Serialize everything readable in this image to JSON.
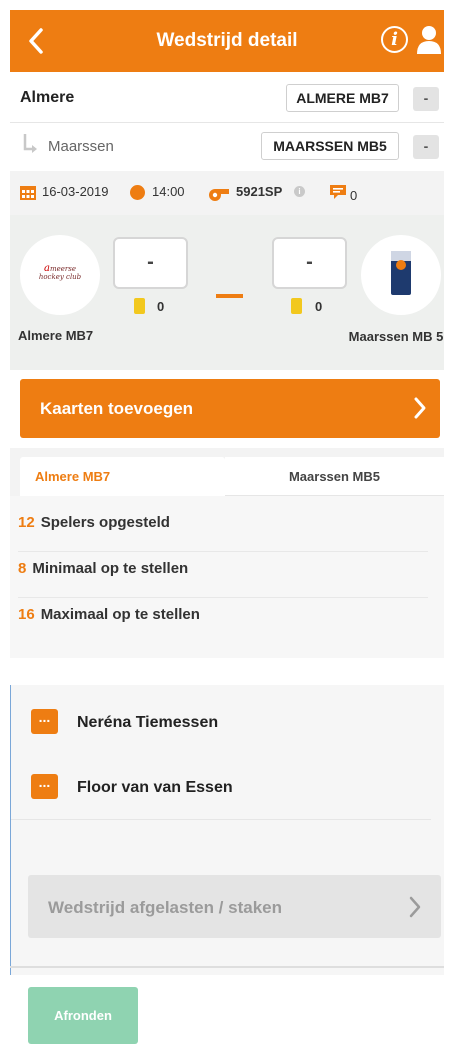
{
  "header": {
    "title": "Wedstrijd detail"
  },
  "home": {
    "name": "Almere",
    "code": "ALMERE MB7",
    "remove_label": "-",
    "logo_text_1": "a",
    "logo_text_2": "meerse",
    "logo_text_3": "hockey club",
    "display": "Almere MB7",
    "score": "-",
    "cards": "0"
  },
  "away": {
    "name": "Maarssen",
    "code": "MAARSSEN MB5",
    "remove_label": "-",
    "display": "Maarssen MB 5",
    "score": "-",
    "cards": "0"
  },
  "info": {
    "date": "16-03-2019",
    "time": "14:00",
    "code": "5921SP",
    "info_glyph": "i",
    "comments": "0"
  },
  "cards_button": {
    "label": "Kaarten toevoegen"
  },
  "tabs": [
    {
      "label": "Almere MB7",
      "active": true
    },
    {
      "label": "Maarssen MB5",
      "active": false
    }
  ],
  "stats": [
    {
      "value": "12",
      "label": "Spelers opgesteld"
    },
    {
      "value": "8",
      "label": "Minimaal op te stellen"
    },
    {
      "value": "16",
      "label": "Maximaal op te stellen"
    }
  ],
  "players": [
    {
      "name": "Neréna Tiemessen",
      "action": "..."
    },
    {
      "name": "Floor van van Essen",
      "action": "..."
    }
  ],
  "cancel_button": {
    "label": "Wedstrijd afgelasten / staken"
  },
  "finish_button": {
    "label": "Afronden"
  },
  "colors": {
    "accent": "#ee7d12",
    "finish": "#8fd3b1",
    "card": "#f2c81e"
  }
}
